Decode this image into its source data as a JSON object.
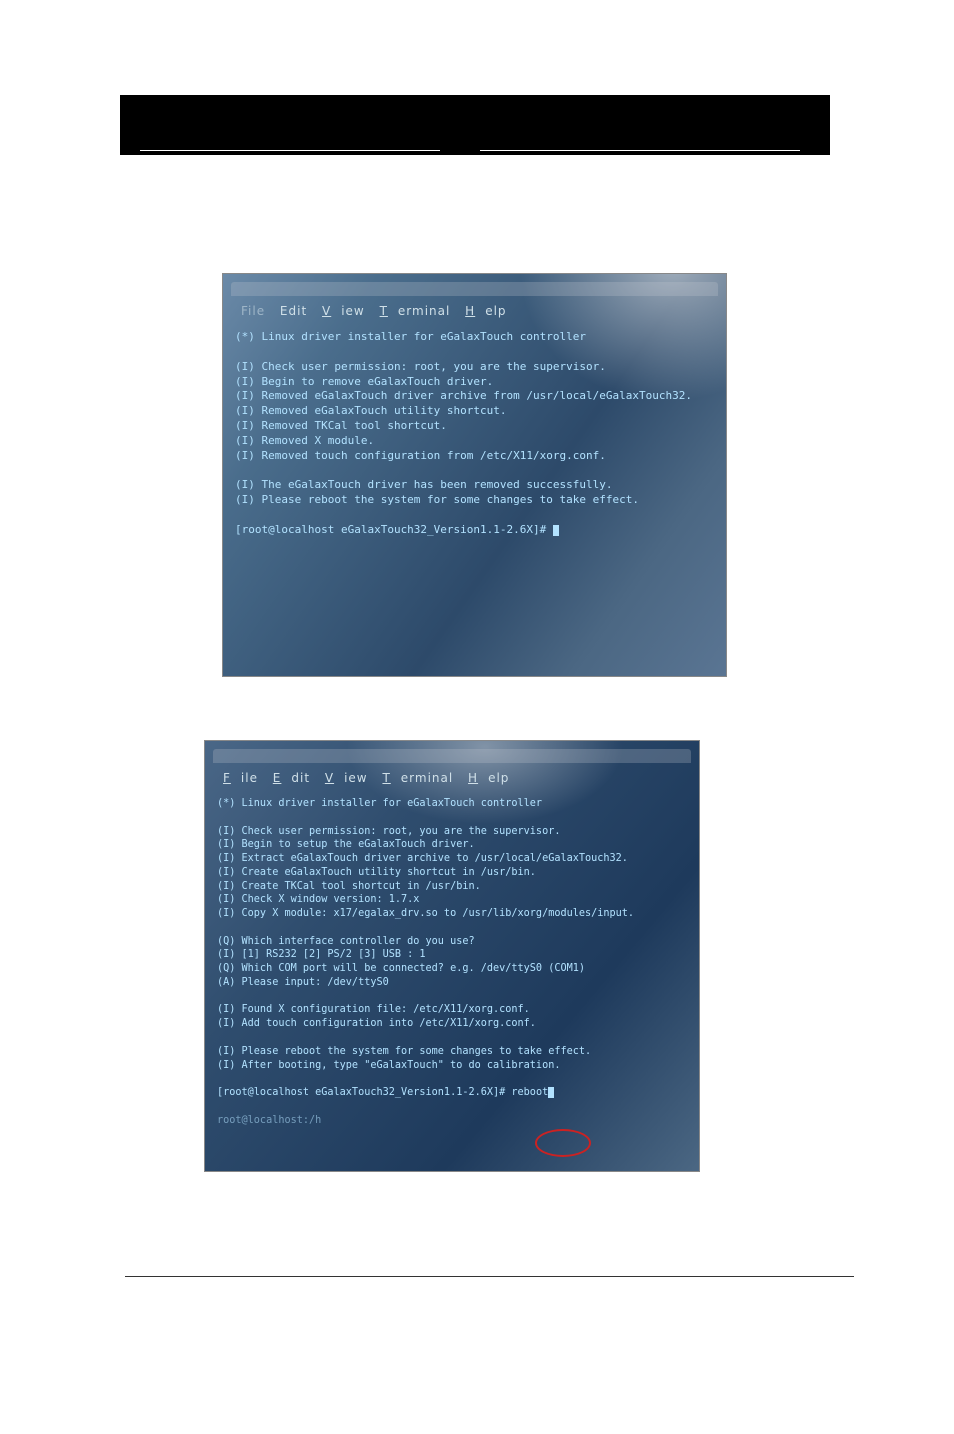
{
  "header": {
    "left": "",
    "right": ""
  },
  "menubar": {
    "file": "File",
    "edit": "Edit",
    "view": "View",
    "terminal": "Terminal",
    "help": "Help"
  },
  "terminal1": {
    "banner": "(*) Linux driver installer for eGalaxTouch controller",
    "l1": "(I) Check user permission: root, you are the supervisor.",
    "l2": "(I) Begin to remove eGalaxTouch driver.",
    "l3": "(I) Removed eGalaxTouch driver archive from /usr/local/eGalaxTouch32.",
    "l4": "(I) Removed eGalaxTouch utility shortcut.",
    "l5": "(I) Removed TKCal tool shortcut.",
    "l6": "(I) Removed X module.",
    "l7": "(I) Removed touch configuration from /etc/X11/xorg.conf.",
    "l8": "(I) The eGalaxTouch driver has been removed successfully.",
    "l9": "(I) Please reboot the system for some changes to take effect.",
    "prompt": "[root@localhost eGalaxTouch32_Version1.1-2.6X]# "
  },
  "terminal2": {
    "banner": "(*) Linux driver installer for eGalaxTouch controller",
    "l1": "(I) Check user permission: root, you are the supervisor.",
    "l2": "(I) Begin to setup the eGalaxTouch driver.",
    "l3": "(I) Extract eGalaxTouch driver archive to /usr/local/eGalaxTouch32.",
    "l4": "(I) Create eGalaxTouch utility shortcut in /usr/bin.",
    "l5": "(I) Create TKCal tool shortcut in /usr/bin.",
    "l6": "(I) Check X window version: 1.7.x",
    "l7": "(I) Copy X module: x17/egalax_drv.so to /usr/lib/xorg/modules/input.",
    "q1": "(Q) Which interface controller do you use?",
    "q2": "(I) [1] RS232 [2] PS/2 [3] USB : 1",
    "q3": "(Q) Which COM port will be connected? e.g. /dev/ttyS0 (COM1)",
    "q4": "(A) Please input: /dev/ttyS0",
    "l8": "(I) Found X configuration file: /etc/X11/xorg.conf.",
    "l9": "(I) Add touch configuration into /etc/X11/xorg.conf.",
    "l10": "(I) Please reboot the system for some changes to take effect.",
    "l11": "(I) After booting, type \"eGalaxTouch\" to do calibration.",
    "prompt": "[root@localhost eGalaxTouch32_Version1.1-2.6X]# ",
    "cmd": "reboot",
    "bottom": "root@localhost:/h"
  }
}
